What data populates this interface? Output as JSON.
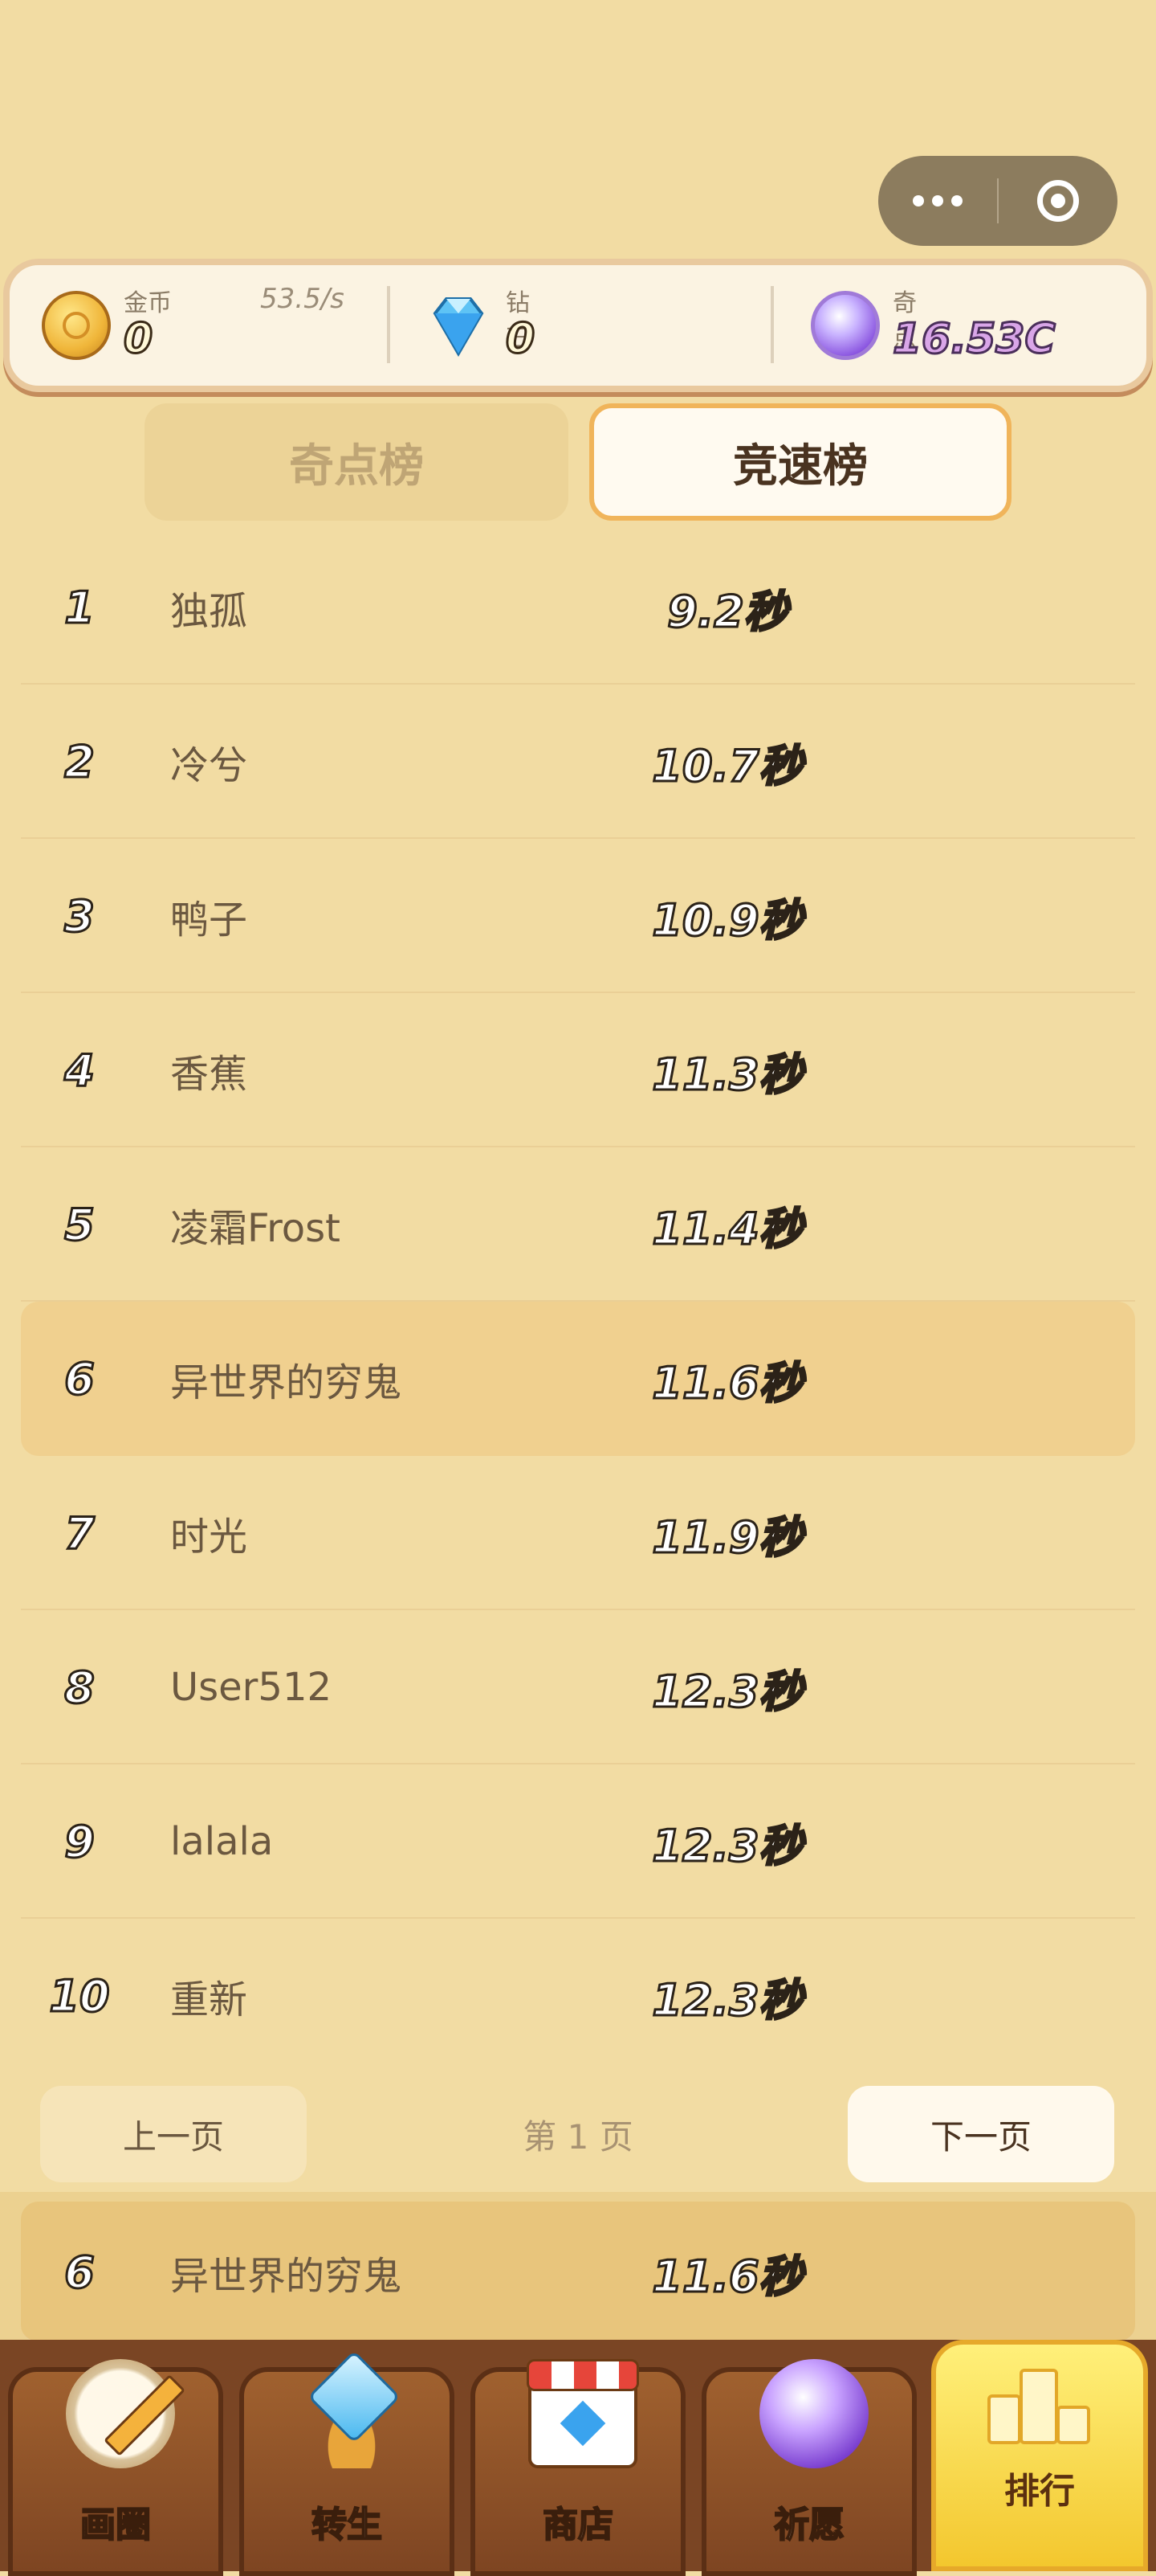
{
  "resources": {
    "coin": {
      "label": "金币",
      "value": "0",
      "rate": "53.5/s",
      "icon": "coin-icon"
    },
    "diamond": {
      "label": "钻石",
      "value": "0",
      "icon": "diamond-icon"
    },
    "qidian": {
      "label": "奇点",
      "value": "16.53C",
      "icon": "orb-icon"
    }
  },
  "tabs": [
    {
      "label": "奇点榜",
      "active": false
    },
    {
      "label": "竞速榜",
      "active": true
    }
  ],
  "leaderboard": [
    {
      "rank": "1",
      "name": "独孤",
      "time": "9.2秒"
    },
    {
      "rank": "2",
      "name": "冷兮",
      "time": "10.7秒"
    },
    {
      "rank": "3",
      "name": "鸭子",
      "time": "10.9秒"
    },
    {
      "rank": "4",
      "name": "香蕉",
      "time": "11.3秒"
    },
    {
      "rank": "5",
      "name": "凌霜Frost",
      "time": "11.4秒"
    },
    {
      "rank": "6",
      "name": "异世界的穷鬼",
      "time": "11.6秒"
    },
    {
      "rank": "7",
      "name": "时光",
      "time": "11.9秒"
    },
    {
      "rank": "8",
      "name": "User512",
      "time": "12.3秒"
    },
    {
      "rank": "9",
      "name": "lalala",
      "time": "12.3秒"
    },
    {
      "rank": "10",
      "name": "重新",
      "time": "12.3秒"
    }
  ],
  "highlight_rank": "6",
  "pagination": {
    "prev": "上一页",
    "info": "第 1 页",
    "next": "下一页"
  },
  "my_rank": {
    "rank": "6",
    "name": "异世界的穷鬼",
    "time": "11.6秒"
  },
  "nav": [
    {
      "label": "画圈",
      "icon": "pencil-icon"
    },
    {
      "label": "转生",
      "icon": "rebirth-icon"
    },
    {
      "label": "商店",
      "icon": "shop-icon"
    },
    {
      "label": "祈愿",
      "icon": "wish-icon"
    },
    {
      "label": "排行",
      "icon": "podium-icon",
      "active": true
    }
  ],
  "colors": {
    "background": "#f2dca3",
    "active_tab_border": "#f0b45a",
    "nav_wood": "#7a4524",
    "nav_active": "#f3c72e"
  }
}
